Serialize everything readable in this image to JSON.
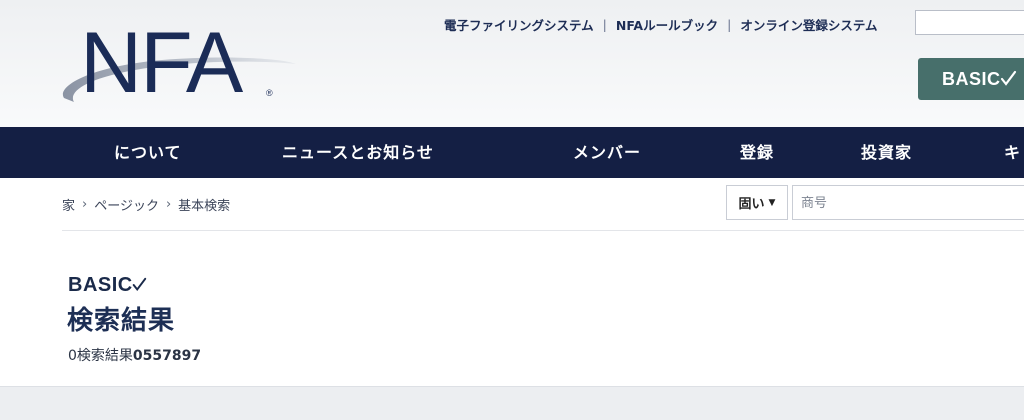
{
  "header": {
    "logo_text": "NFA",
    "top_links": [
      "電子ファイリングシステム",
      "NFAルールブック",
      "オンライン登録システム"
    ],
    "top_links_separator": "|",
    "search_value": "",
    "basic_button_label": "BASIC"
  },
  "nav": {
    "items": [
      "について",
      "ニュースとお知らせ",
      "メンバー",
      "登録",
      "投資家",
      "キ"
    ]
  },
  "breadcrumb": {
    "items": [
      "家",
      "ページック",
      "基本検索"
    ],
    "separator": "›"
  },
  "search_bar": {
    "filter_selected": "固い",
    "input_placeholder": "商号",
    "input_value": ""
  },
  "results": {
    "brand_label": "BASIC",
    "title": "検索結果",
    "count": "0",
    "count_label": "検索結果",
    "query_id": "0557897"
  },
  "colors": {
    "nav_bg": "#141f44",
    "brand_navy": "#1d2f55",
    "basic_button_bg": "#476f6b",
    "logo_swoosh": "#8a93a3"
  }
}
